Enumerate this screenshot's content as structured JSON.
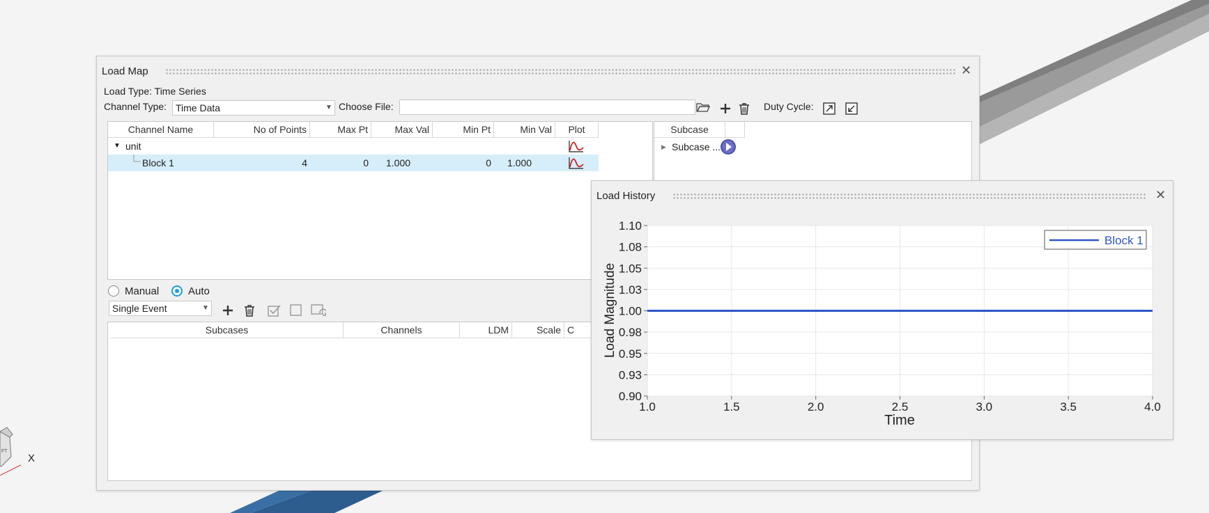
{
  "load_map": {
    "title": "Load Map",
    "load_type": "Load Type: Time Series",
    "channel_type_label": "Channel Type:",
    "channel_type_value": "Time Data",
    "choose_file_label": "Choose File:",
    "choose_file_value": "",
    "duty_cycle_label": "Duty Cycle:",
    "channel_table": {
      "headers": [
        "Channel Name",
        "No of Points",
        "Max Pt",
        "Max Val",
        "Min Pt",
        "Min Val",
        "Plot"
      ],
      "group_row": {
        "name": "unit"
      },
      "rows": [
        {
          "name": "Block 1",
          "points": "4",
          "max_pt": "0",
          "max_val": "1.000",
          "min_pt": "0",
          "min_val": "1.000"
        }
      ]
    },
    "subcase_table": {
      "header": "Subcase",
      "row_label": "Subcase ..."
    },
    "mode": {
      "manual_label": "Manual",
      "auto_label": "Auto",
      "selected": "Auto"
    },
    "event_type_value": "Single Event",
    "bottom_table": {
      "headers": [
        "Subcases",
        "Channels",
        "LDM",
        "Scale",
        "C"
      ]
    }
  },
  "load_history": {
    "title": "Load History"
  },
  "axis_triad": {
    "x_label": "X"
  },
  "colors": {
    "series": "#2e56c8",
    "selected_row": "#d6eefa",
    "accent": "#1a9de0"
  },
  "chart_data": {
    "type": "line",
    "xlabel": "Time",
    "ylabel": "Load Magnitude",
    "xlim": [
      1.0,
      4.0
    ],
    "ylim": [
      0.9,
      1.1
    ],
    "x_ticks": [
      "1.0",
      "1.5",
      "2.0",
      "2.5",
      "3.0",
      "3.5",
      "4.0"
    ],
    "y_ticks": [
      "1.10",
      "1.08",
      "1.05",
      "1.03",
      "1.00",
      "0.98",
      "0.95",
      "0.93",
      "0.90"
    ],
    "legend_position": "top-right",
    "grid": true,
    "series": [
      {
        "name": "Block 1",
        "x": [
          1.0,
          2.0,
          3.0,
          4.0
        ],
        "y": [
          1.0,
          1.0,
          1.0,
          1.0
        ]
      }
    ]
  }
}
